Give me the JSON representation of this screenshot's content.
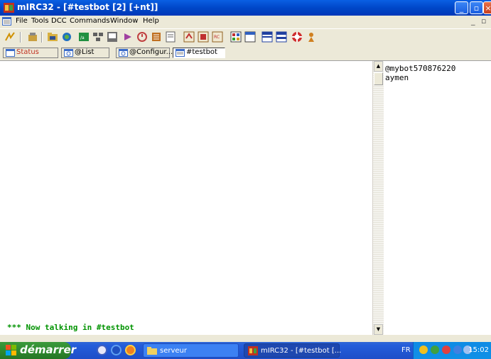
{
  "window": {
    "title": "mIRC32 - [#testbot [2] [+nt]]",
    "controls": [
      "minimize",
      "restore",
      "close"
    ]
  },
  "menubar": {
    "items": [
      "File",
      "Tools",
      "DCC",
      "Commands",
      "Window",
      "Help"
    ],
    "mdi_controls": [
      "_",
      "▫"
    ]
  },
  "toolbar": {
    "icons": [
      "connect-icon",
      "options-icon",
      "channels-folder-icon",
      "address-book-icon",
      "scripts-icon",
      "dcc-send-icon",
      "dcc-chat-icon",
      "notify-icon",
      "timer-icon",
      "urls-icon",
      "colors-icon",
      "received-files-icon",
      "log-files-icon",
      "notify-list-icon",
      "tile-icon",
      "cascade-icon",
      "tile-horizontal-icon",
      "tile-vertical-icon",
      "help-icon",
      "about-icon"
    ]
  },
  "switchbar": {
    "tabs": [
      {
        "label": "Status",
        "active": false
      },
      {
        "label": "@List",
        "active": false
      },
      {
        "label": "@Configur...",
        "active": false
      },
      {
        "label": "#testbot",
        "active": true
      }
    ]
  },
  "chat": {
    "lines": [
      "*** Now talking in #testbot"
    ]
  },
  "nicklist": {
    "nicks": [
      "@mybot570876220",
      "aymen"
    ]
  },
  "taskbar": {
    "start_label": "démarrer",
    "tasks": [
      {
        "label": "serveur",
        "active": false
      },
      {
        "label": "mIRC32 - [#testbot [...",
        "active": true
      }
    ],
    "language": "FR",
    "clock": "15:02"
  },
  "colors": {
    "chat_text": "#009300",
    "title_bar": "#0A5FE3",
    "taskbar": "#245DDA",
    "start_button": "#2F8A2F"
  }
}
